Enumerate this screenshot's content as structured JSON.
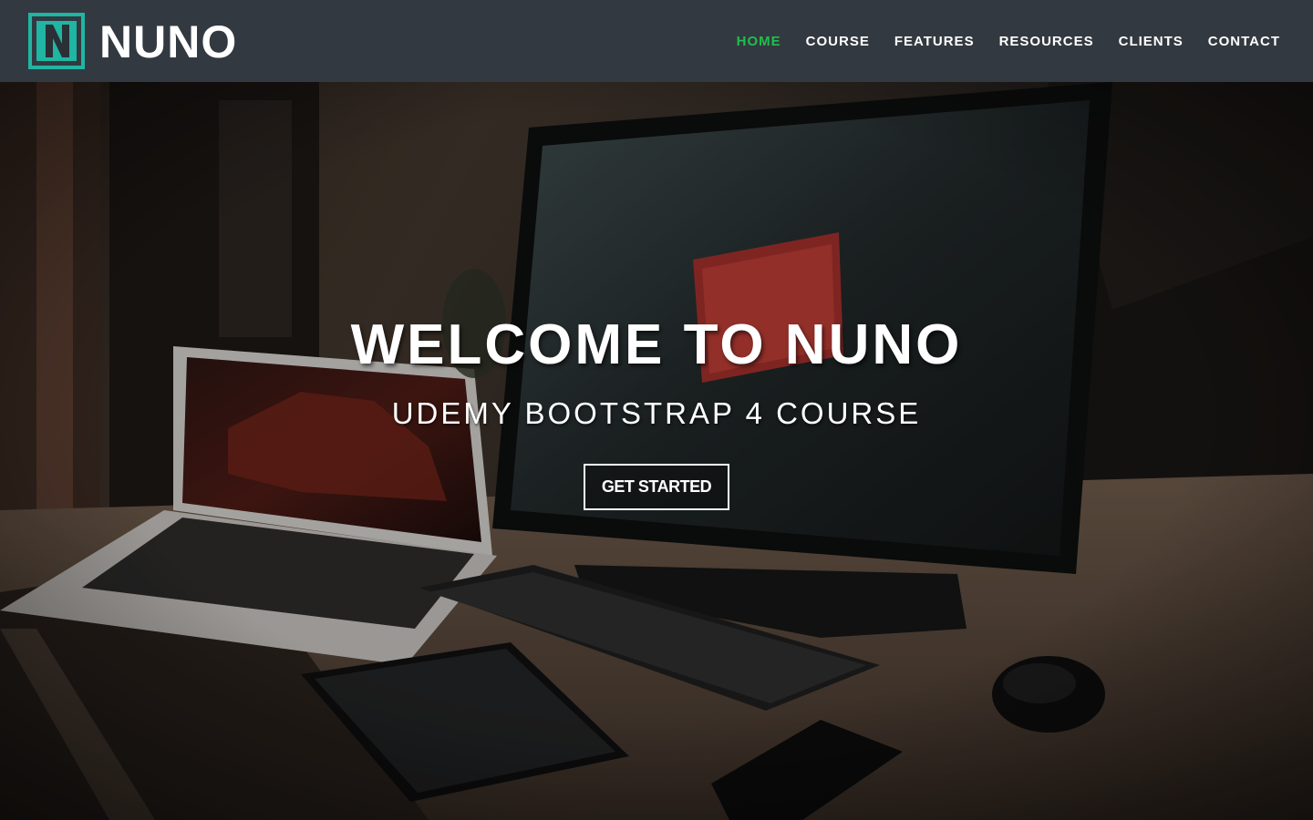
{
  "brand": {
    "name": "NUNO",
    "mark_letter": "N",
    "colors": {
      "accent": "#1fb6a3",
      "navbar": "#333940",
      "active_link": "#1fbf4a"
    }
  },
  "nav": {
    "items": [
      {
        "label": "HOME",
        "active": true
      },
      {
        "label": "COURSE",
        "active": false
      },
      {
        "label": "FEATURES",
        "active": false
      },
      {
        "label": "RESOURCES",
        "active": false
      },
      {
        "label": "CLIENTS",
        "active": false
      },
      {
        "label": "CONTACT",
        "active": false
      }
    ]
  },
  "hero": {
    "title": "WELCOME TO NUNO",
    "subtitle": "UDEMY BOOTSTRAP 4 COURSE",
    "cta_label": "GET STARTED",
    "background": "desk-workspace-photo"
  }
}
